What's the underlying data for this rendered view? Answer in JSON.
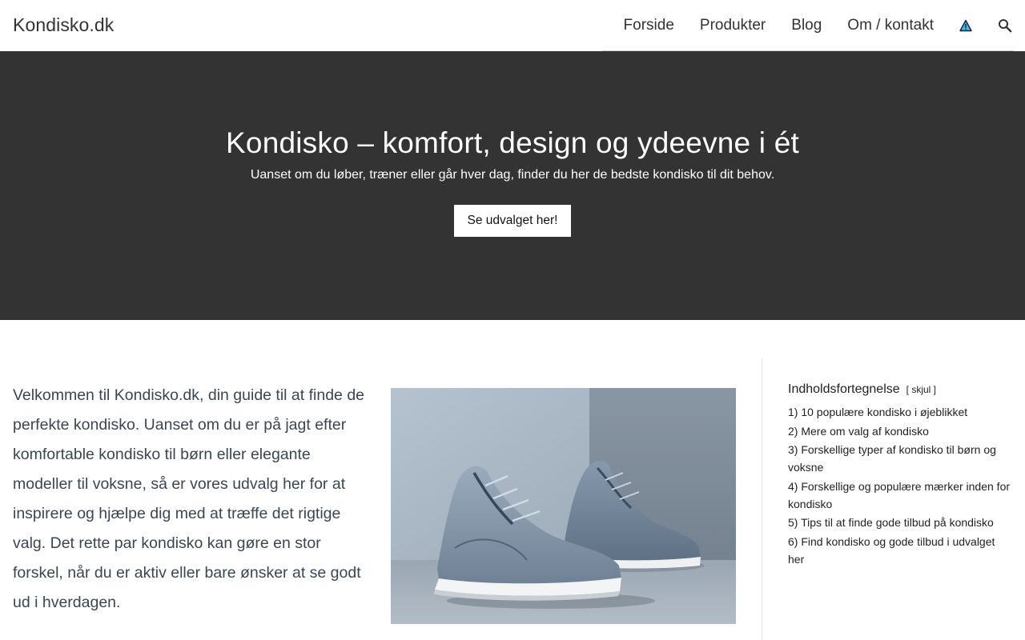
{
  "header": {
    "site_title": "Kondisko.dk",
    "nav": [
      {
        "label": "Forside"
      },
      {
        "label": "Produkter"
      },
      {
        "label": "Blog"
      },
      {
        "label": "Om / kontakt"
      }
    ],
    "icons": [
      "warning-icon",
      "search-icon"
    ]
  },
  "hero": {
    "title": "Kondisko – komfort, design og ydeevne i ét",
    "subtitle": "Uanset om du løber, træner eller går hver dag, finder du her de bedste kondisko til dit behov.",
    "button_label": "Se udvalget her!",
    "background_color": "#333333"
  },
  "main": {
    "intro_text": "Velkommen til Kondisko.dk, din guide til at finde de perfekte kondisko. Uanset om du er på jagt efter komfortable kondisko til børn eller elegante modeller til voksne, så er vores udvalg her for at inspirere og hjælpe dig med at træffe det rigtige valg. Det rette par kondisko kan gøre en stor forskel, når du er aktiv eller bare ønsker at se godt ud i hverdagen."
  },
  "toc": {
    "title": "Indholdsfortegnelse",
    "toggle_label": "[ skjul ]",
    "items": [
      {
        "label": "1) 10 populære kondisko i øjeblikket"
      },
      {
        "label": "2) Mere om valg af kondisko"
      },
      {
        "label": "3) Forskellige typer af kondisko til børn og voksne"
      },
      {
        "label": "4) Forskellige og populære mærker inden for kondisko"
      },
      {
        "label": "5) Tips til at finde gode tilbud på kondisko"
      },
      {
        "label": "6) Find kondisko og gode tilbud i udvalget her"
      }
    ]
  }
}
